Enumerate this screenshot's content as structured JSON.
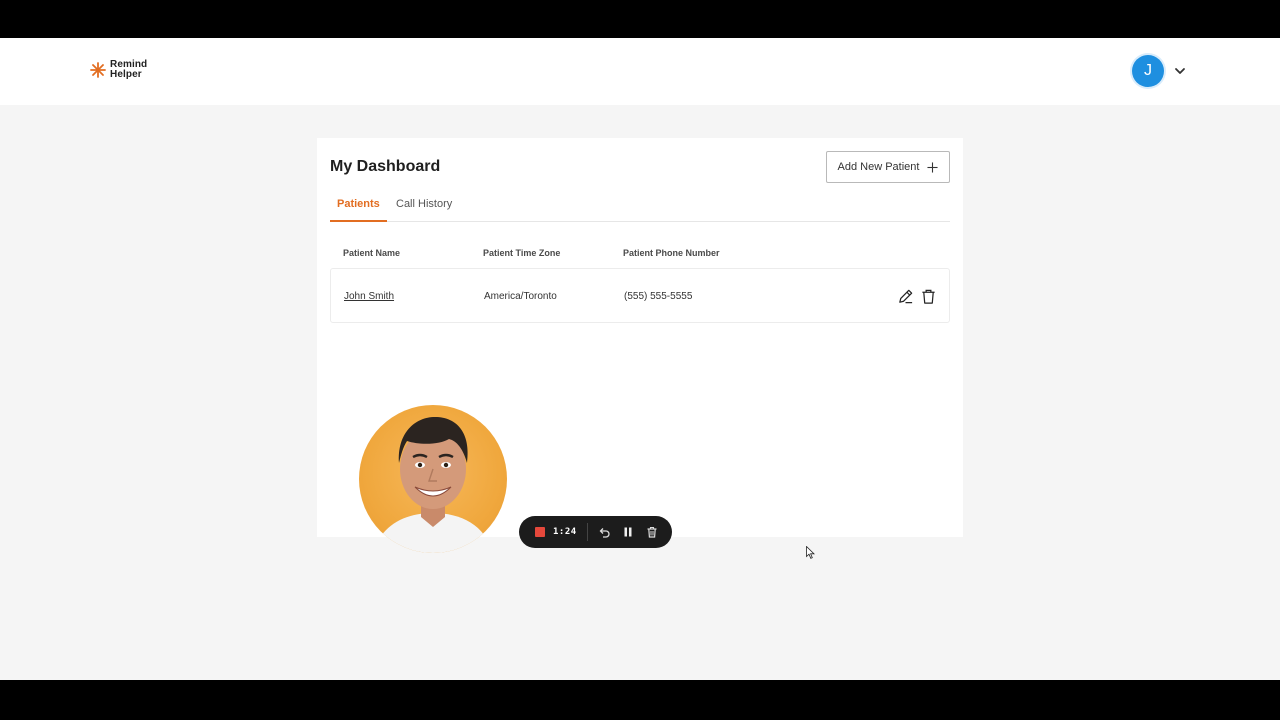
{
  "app": {
    "logo_line1": "Remind",
    "logo_line2": "Helper",
    "brand_color": "#e26d21"
  },
  "user": {
    "avatar_initial": "J",
    "avatar_color": "#1e8fe0"
  },
  "dashboard": {
    "title": "My Dashboard",
    "add_button_label": "Add New Patient",
    "tabs": [
      {
        "label": "Patients",
        "active": true
      },
      {
        "label": "Call History",
        "active": false
      }
    ],
    "columns": [
      "Patient Name",
      "Patient Time Zone",
      "Patient Phone Number"
    ],
    "rows": [
      {
        "name": "John Smith",
        "timezone": "America/Toronto",
        "phone": "(555) 555-5555"
      }
    ]
  },
  "recorder": {
    "time": "1:24",
    "stop_color": "#e5483b"
  },
  "icons": [
    "logo-star-icon",
    "chevron-down-icon",
    "plus-icon",
    "edit-icon",
    "trash-icon",
    "stop-icon",
    "undo-icon",
    "pause-icon",
    "delete-icon",
    "cursor-icon"
  ]
}
